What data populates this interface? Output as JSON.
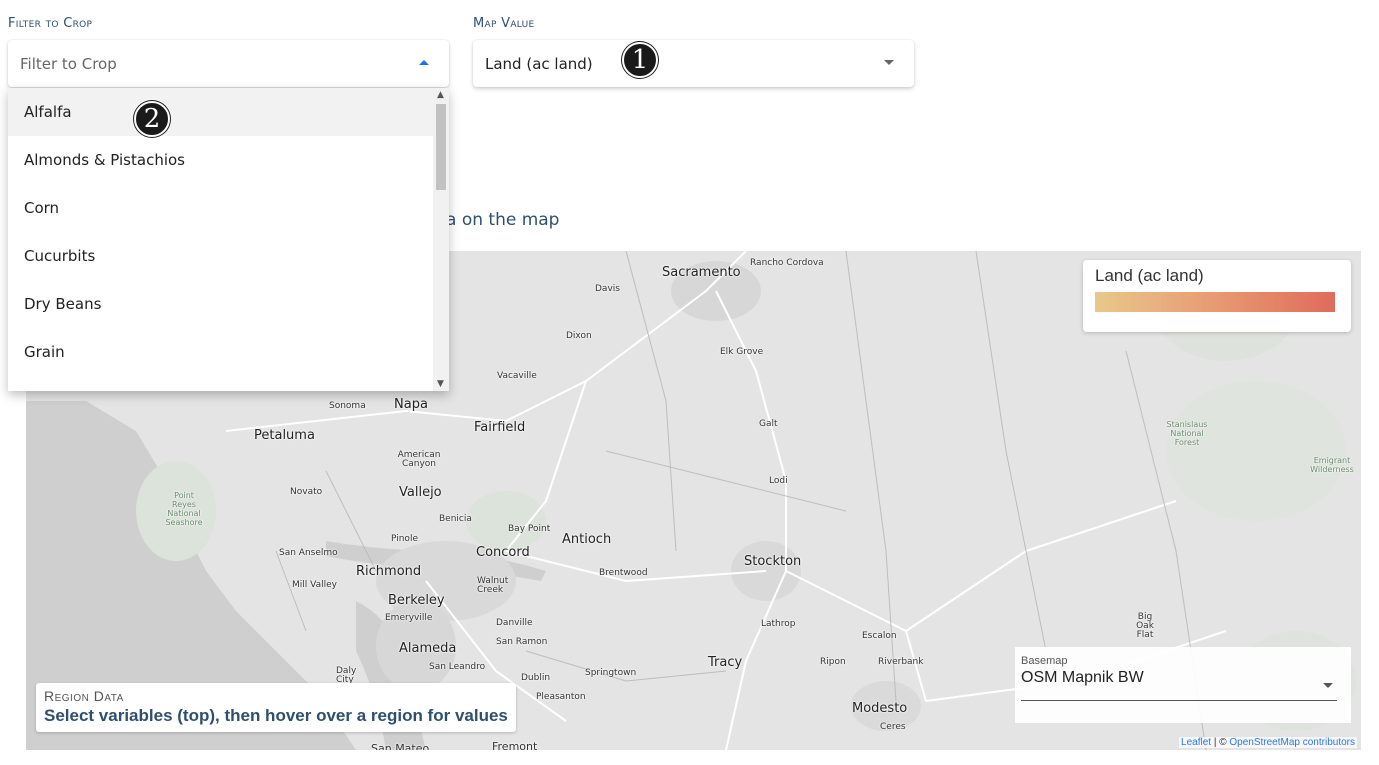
{
  "filter_crop": {
    "label": "Filter to Crop",
    "placeholder": "Filter to Crop",
    "options": [
      "Alfalfa",
      "Almonds & Pistachios",
      "Corn",
      "Cucurbits",
      "Dry Beans",
      "Grain"
    ]
  },
  "map_value": {
    "label": "Map Value",
    "value": "Land (ac land)"
  },
  "badges": {
    "one": "1",
    "two": "2"
  },
  "hint_text": "a on the map",
  "map": {
    "places": {
      "sacramento": "Sacramento",
      "rancho_cordova": "Rancho Cordova",
      "davis": "Davis",
      "dixon": "Dixon",
      "elk_grove": "Elk Grove",
      "vacaville": "Vacaville",
      "sonoma": "Sonoma",
      "napa": "Napa",
      "fairfield": "Fairfield",
      "petaluma": "Petaluma",
      "american_canyon": "American Canyon",
      "novato": "Novato",
      "vallejo": "Vallejo",
      "benicia": "Benicia",
      "bay_point": "Bay Point",
      "antioch": "Antioch",
      "pinole": "Pinole",
      "concord": "Concord",
      "san_anselmo": "San Anselmo",
      "richmond": "Richmond",
      "brentwood": "Brentwood",
      "mill_valley": "Mill Valley",
      "walnut_creek": "Walnut Creek",
      "berkeley": "Berkeley",
      "emeryville": "Emeryville",
      "danville": "Danville",
      "alameda": "Alameda",
      "san_ramon": "San Ramon",
      "san_leandro": "San Leandro",
      "daly_city": "Daly City",
      "dublin": "Dublin",
      "springtown": "Springtown",
      "pleasanton": "Pleasanton",
      "san_mateo": "San Mateo",
      "fremont": "Fremont",
      "galt": "Galt",
      "lodi": "Lodi",
      "stockton": "Stockton",
      "lathrop": "Lathrop",
      "tracy": "Tracy",
      "ripon": "Ripon",
      "riverbank": "Riverbank",
      "escalon": "Escalon",
      "modesto": "Modesto",
      "ceres": "Ceres",
      "big_oak_flat": "Big Oak Flat",
      "stanislaus": "Stanislaus National Forest",
      "emigrant": "Emigrant Wilderness",
      "point_reyes": "Point Reyes National Seashore"
    },
    "legend_title": "Land (ac land)",
    "legend_colors": [
      "#e8c98a",
      "#e06b5c"
    ],
    "region_title": "Region Data",
    "region_subtitle": "Select variables (top), then hover over a region for values",
    "basemap_label": "Basemap",
    "basemap_value": "OSM Mapnik BW",
    "attribution_leaflet": "Leaflet",
    "attribution_sep": " | © ",
    "attribution_osm": "OpenStreetMap contributors"
  }
}
